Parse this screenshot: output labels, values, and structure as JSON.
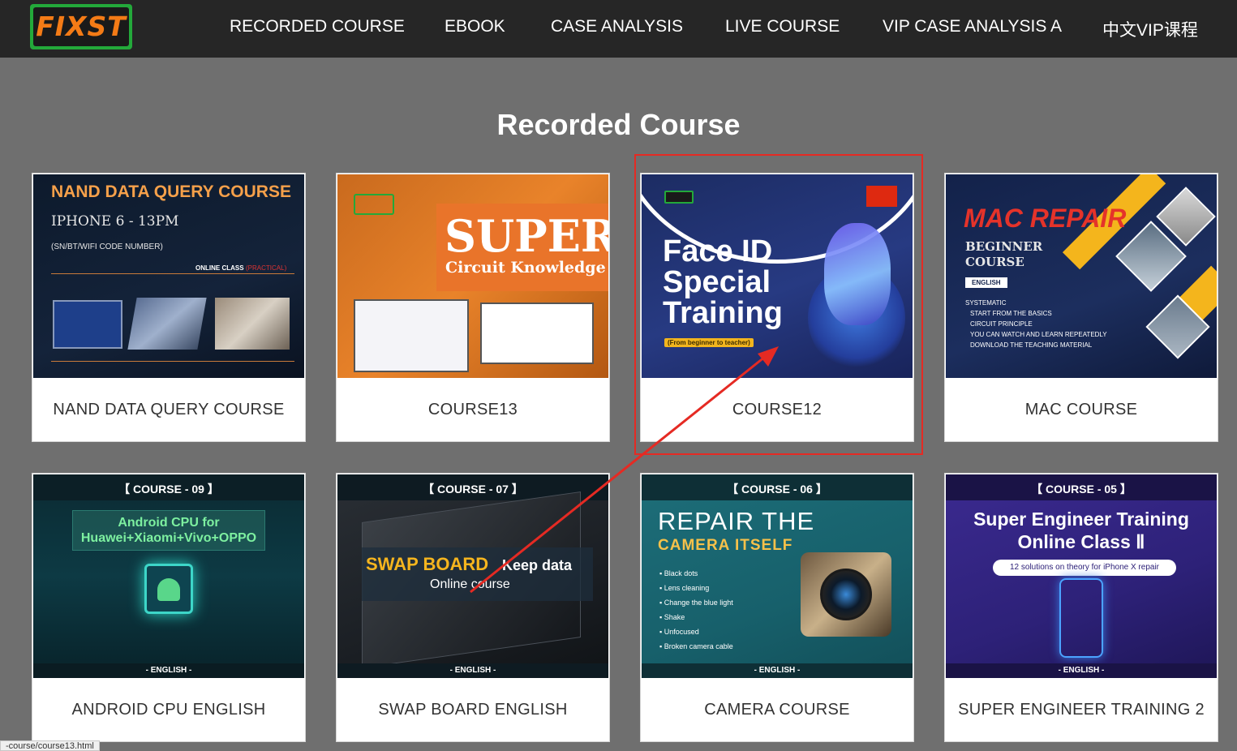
{
  "nav": {
    "logo_text": "FIXST",
    "links": [
      "RECORDED COURSE",
      "EBOOK",
      "CASE ANALYSIS",
      "LIVE COURSE",
      "VIP CASE ANALYSIS A",
      "中文VIP课程"
    ]
  },
  "page_title": "Recorded Course",
  "cards": [
    {
      "label": "NAND DATA QUERY COURSE",
      "thumb": {
        "heading": "NAND DATA QUERY COURSE",
        "line1": "IPHONE 6 - 13PM",
        "line2": "(SN/BT/WIFI CODE NUMBER)",
        "online": "ONLINE CLASS",
        "practical": "(PRACTICAL)"
      }
    },
    {
      "label": "COURSE13",
      "thumb": {
        "big": "SUPER",
        "sub": "Circuit Knowledge"
      }
    },
    {
      "label": "COURSE12",
      "thumb": {
        "line1": "Face ID",
        "line2": "Special",
        "line3": "Training",
        "pill": "(From beginner to teacher)"
      }
    },
    {
      "label": "MAC COURSE",
      "thumb": {
        "heading": "MAC REPAIR",
        "sub1": "BEGINNER",
        "sub2": "COURSE",
        "badge": "ENGLISH",
        "bullets": [
          "SYSTEMATIC",
          "START FROM THE BASICS",
          "CIRCUIT PRINCIPLE",
          "YOU CAN WATCH AND LEARN REPEATEDLY",
          "DOWNLOAD THE TEACHING MATERIAL"
        ]
      }
    },
    {
      "label": "ANDROID CPU ENGLISH",
      "thumb": {
        "tag": "【 COURSE - 09 】",
        "line1": "Android CPU for",
        "line2": "Huawei+Xiaomi+Vivo+OPPO",
        "footer": "- ENGLISH -"
      }
    },
    {
      "label": "SWAP BOARD ENGLISH",
      "thumb": {
        "tag": "【 COURSE - 07 】",
        "swap": "SWAP BOARD",
        "keep": "Keep data",
        "online": "Online course",
        "footer": "- ENGLISH -"
      }
    },
    {
      "label": "CAMERA COURSE",
      "thumb": {
        "tag": "【 COURSE - 06 】",
        "line1": "REPAIR THE",
        "line2": "CAMERA ITSELF",
        "items": [
          "Black dots",
          "Lens cleaning",
          "Change the blue light",
          "Shake",
          "Unfocused",
          "Broken camera cable"
        ],
        "footer": "- ENGLISH -"
      }
    },
    {
      "label": "SUPER ENGINEER TRAINING 2",
      "thumb": {
        "tag": "【 COURSE - 05 】",
        "line1": "Super Engineer Training",
        "line2": "Online Class Ⅱ",
        "pill": "12 solutions on theory for iPhone X repair",
        "footer": "- ENGLISH -"
      }
    }
  ],
  "status_url": "-course/course13.html",
  "colors": {
    "nav_bg": "#262626",
    "page_bg": "#6f6f6f",
    "highlight": "#e52a23",
    "logo_green": "#23a93a",
    "logo_orange": "#f47b16"
  }
}
